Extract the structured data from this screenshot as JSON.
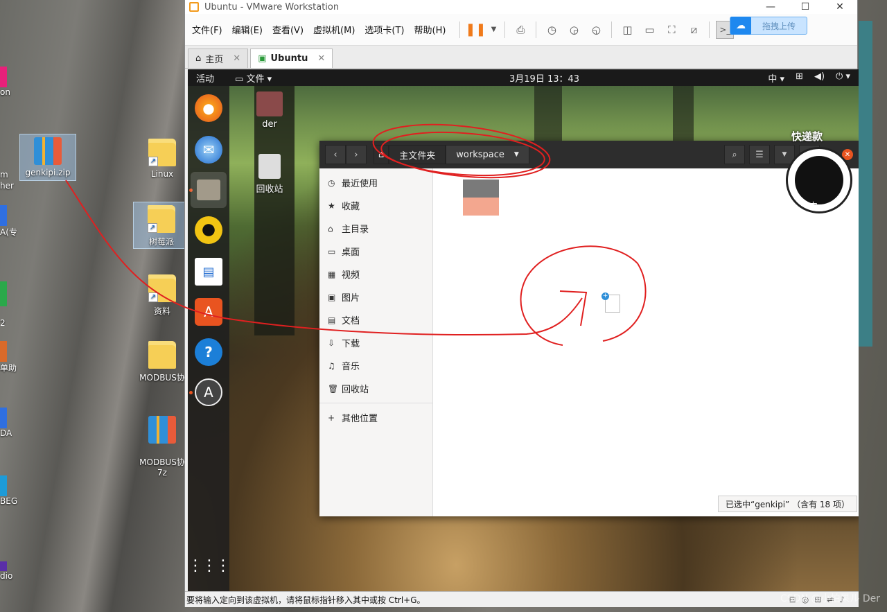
{
  "host": {
    "icons": [
      {
        "label": "genkipi.zip"
      },
      {
        "label": "Linux"
      },
      {
        "label": "树莓派"
      },
      {
        "label": "资料"
      },
      {
        "label": "MODBUS协"
      },
      {
        "label": "MODBUS协\n7z"
      }
    ],
    "left_fragments": [
      "on",
      "m\nher",
      "A(专",
      "2\n...",
      "单助",
      "DA",
      "BEG",
      "dio"
    ]
  },
  "vmware": {
    "title": "Ubuntu  - VMware Workstation",
    "menu": [
      "文件(F)",
      "编辑(E)",
      "查看(V)",
      "虚拟机(M)",
      "选项卡(T)",
      "帮助(H)"
    ],
    "baidu_label": "拖拽上传",
    "tabs": [
      {
        "label": "主页"
      },
      {
        "label": "Ubuntu"
      }
    ],
    "statusbar": "要将输入定向到该虚拟机，请将鼠标指针移入其中或按 Ctrl+G。"
  },
  "guest": {
    "topbar": {
      "activities": "活动",
      "app": "文件",
      "clock": "3月19日  13：43",
      "input": "中"
    },
    "desktop_icons": [
      {
        "label": "der"
      },
      {
        "label": "回收站"
      }
    ],
    "nautilus": {
      "breadcrumbs": [
        "主文件夹",
        "workspace"
      ],
      "sidebar": [
        "最近使用",
        "收藏",
        "主目录",
        "桌面",
        "视频",
        "图片",
        "文档",
        "下载",
        "音乐",
        "回收站"
      ],
      "other": "其他位置",
      "status": "已选中“genkipi” （含有 18 项）"
    }
  },
  "overlay": {
    "avatar_label": "快递款",
    "avatar_sub": "中",
    "watermark": "CSDN @小怕果ル Der"
  }
}
